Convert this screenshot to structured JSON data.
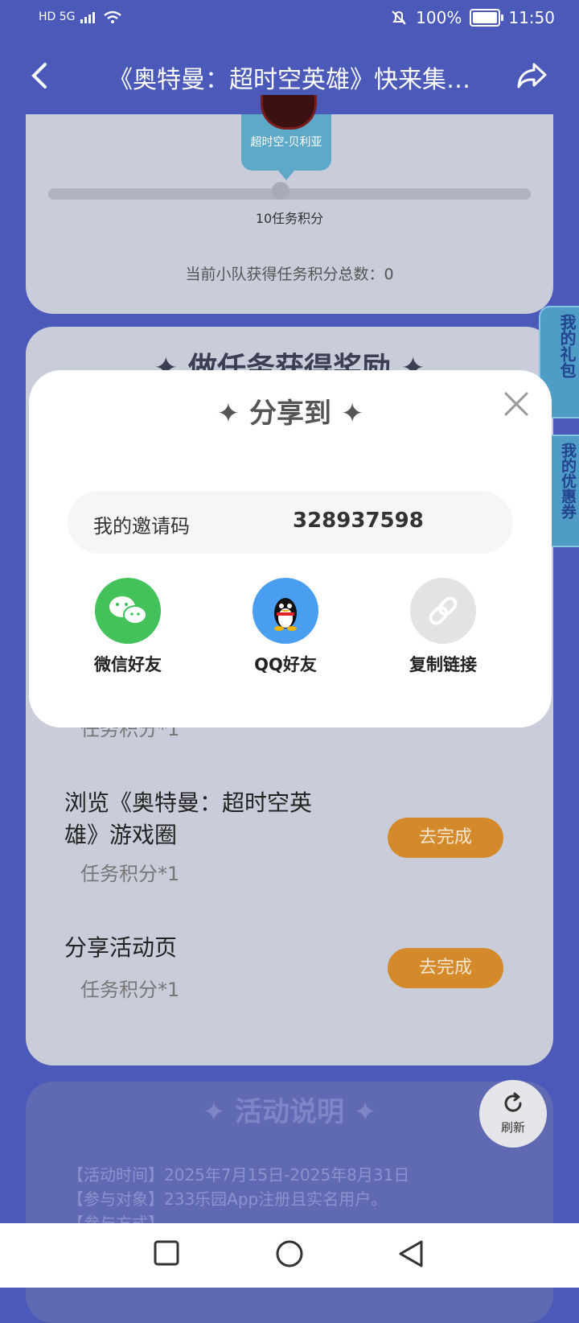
{
  "status_bar": {
    "network": "HD 5G",
    "battery_pct": "100%",
    "time": "11:50",
    "battery_level": 1.0
  },
  "nav": {
    "title": "《奥特曼：超时空英雄》快来集…"
  },
  "card_progress": {
    "reward_name": "超时空-贝利亚",
    "milestone_label": "10任务积分",
    "team_points_text": "当前小队获得任务积分总数：0"
  },
  "card_tasks": {
    "title": "做任务获得奖励",
    "tasks": [
      {
        "points": "任务积分*1"
      },
      {
        "title": "浏览《奥特曼：超时空英雄》游戏圈",
        "points": "任务积分*1",
        "button": "去完成"
      },
      {
        "title": "分享活动页",
        "points": "任务积分*1",
        "button": "去完成"
      }
    ]
  },
  "side_tabs": {
    "gifts": "我的礼包",
    "coupons": "我的优惠券"
  },
  "activity": {
    "title": "活动说明",
    "lines": [
      "【活动时间】2025年7月15日-2025年8月31日",
      "【参与对象】233乐园App注册且实名用户。",
      "【参与方式】"
    ]
  },
  "refresh": {
    "label": "刷新"
  },
  "modal": {
    "title": "分享到",
    "invite_label": "我的邀请码",
    "invite_code": "328937598",
    "share_options": [
      {
        "label": "微信好友",
        "icon": "wechat-icon",
        "color": "#43c15a"
      },
      {
        "label": "QQ好友",
        "icon": "qq-icon",
        "color": "#4a9ef0"
      },
      {
        "label": "复制链接",
        "icon": "link-icon",
        "color": "#e3e3e5"
      }
    ]
  },
  "colors": {
    "background": "#4b59b8",
    "accent_orange": "#d48a2b"
  }
}
